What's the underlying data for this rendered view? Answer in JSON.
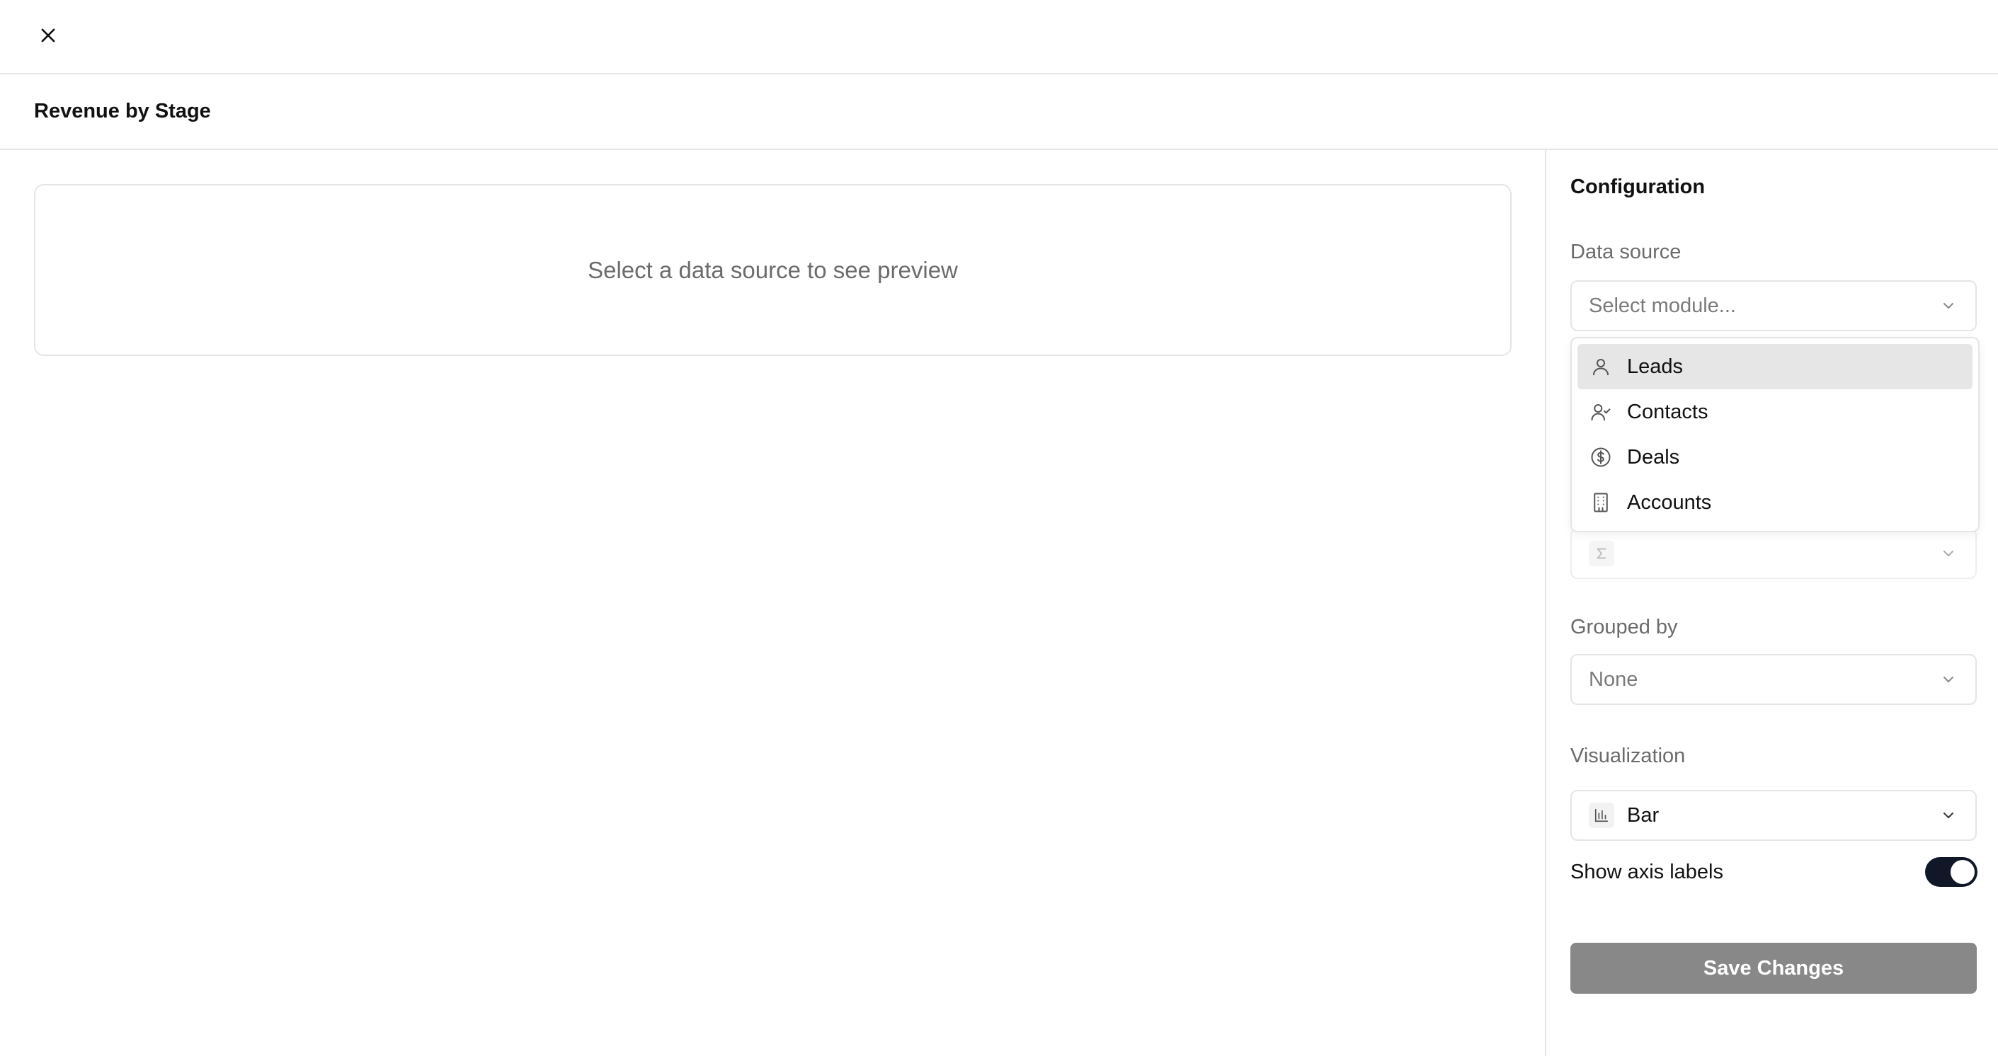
{
  "header": {
    "close_icon": "close-icon"
  },
  "title": "Revenue by Stage",
  "preview": {
    "message": "Select a data source to see preview"
  },
  "config": {
    "title": "Configuration",
    "data_source": {
      "label": "Data source",
      "placeholder": "Select module...",
      "options": [
        {
          "label": "Leads",
          "icon": "user-icon",
          "highlighted": true
        },
        {
          "label": "Contacts",
          "icon": "user-check-icon",
          "highlighted": false
        },
        {
          "label": "Deals",
          "icon": "dollar-circle-icon",
          "highlighted": false
        },
        {
          "label": "Accounts",
          "icon": "building-icon",
          "highlighted": false
        }
      ]
    },
    "measure": {
      "icon": "sigma-icon",
      "value": ""
    },
    "grouped_by": {
      "label": "Grouped by",
      "value": "None"
    },
    "visualization": {
      "label": "Visualization",
      "value": "Bar",
      "icon": "bar-chart-icon"
    },
    "show_axis_labels": {
      "label": "Show axis labels",
      "enabled": true
    },
    "save_label": "Save Changes"
  },
  "colors": {
    "toggle_on": "#101828",
    "save_disabled": "#888888",
    "border": "#e5e5e5",
    "highlight": "#e6e6e6"
  }
}
